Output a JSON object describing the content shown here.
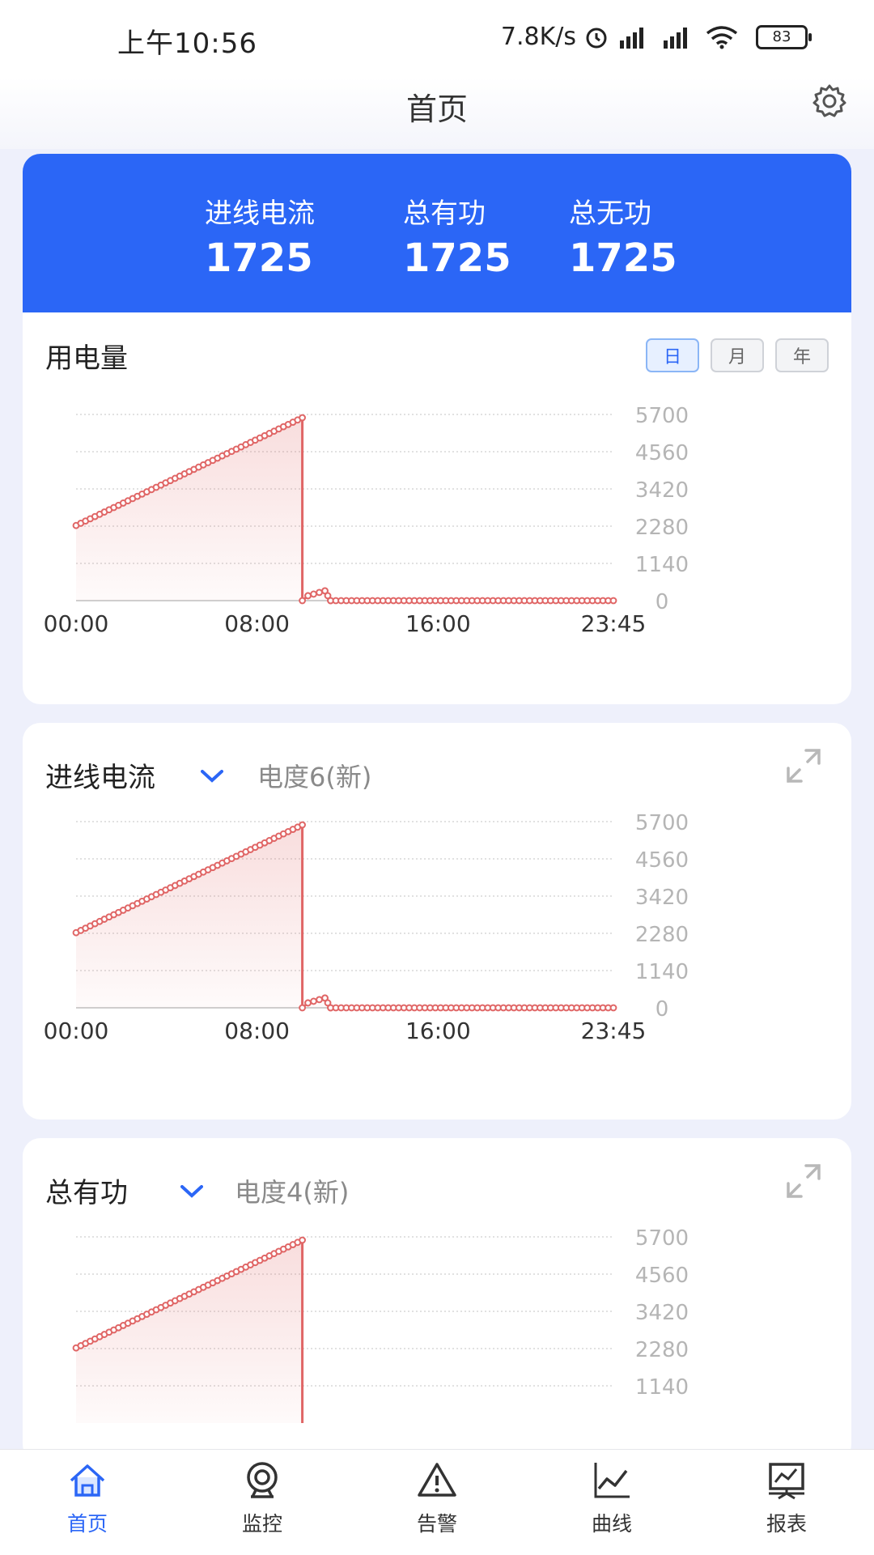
{
  "status": {
    "time": "上午10:56",
    "speed": "7.8K/s",
    "battery": "83"
  },
  "header": {
    "title": "首页",
    "settings_icon": "gear-icon"
  },
  "summary": {
    "metrics": [
      {
        "label": "进线电流",
        "value": "1725"
      },
      {
        "label": "总有功",
        "value": "1725"
      },
      {
        "label": "总无功",
        "value": "1725"
      }
    ]
  },
  "cards": [
    {
      "title": "用电量",
      "range_buttons": [
        "日",
        "月",
        "年"
      ],
      "selected_range": "日"
    },
    {
      "title": "进线电流",
      "dropdown_icon": "chevron-down-icon",
      "subtitle": "电度6(新)",
      "expand_icon": "expand-icon"
    },
    {
      "title": "总有功",
      "dropdown_icon": "chevron-down-icon",
      "subtitle": "电度4(新)",
      "expand_icon": "expand-icon"
    }
  ],
  "colors": {
    "accent": "#2b66f6",
    "series": "#e06666",
    "grid": "#cfcfcf"
  },
  "tabs": [
    {
      "label": "首页",
      "icon": "home-icon",
      "active": true
    },
    {
      "label": "监控",
      "icon": "camera-icon",
      "active": false
    },
    {
      "label": "告警",
      "icon": "warning-icon",
      "active": false
    },
    {
      "label": "曲线",
      "icon": "line-chart-icon",
      "active": false
    },
    {
      "label": "报表",
      "icon": "report-icon",
      "active": false
    }
  ],
  "chart_data": [
    {
      "type": "area",
      "x_ticks": [
        "00:00",
        "08:00",
        "16:00",
        "23:45"
      ],
      "y_ticks": [
        "0",
        "1140",
        "2280",
        "3420",
        "4560",
        "5700"
      ],
      "ylim": [
        0,
        5700
      ],
      "grid": true,
      "series": [
        {
          "x": [
            "00:00",
            "10:00",
            "10:00",
            "10:15",
            "11:00",
            "11:15",
            "23:45"
          ],
          "values": [
            2300,
            5600,
            0,
            150,
            300,
            0,
            0
          ]
        }
      ]
    },
    {
      "type": "area",
      "x_ticks": [
        "00:00",
        "08:00",
        "16:00",
        "23:45"
      ],
      "y_ticks": [
        "0",
        "1140",
        "2280",
        "3420",
        "4560",
        "5700"
      ],
      "ylim": [
        0,
        5700
      ],
      "grid": true,
      "series": [
        {
          "x": [
            "00:00",
            "10:00",
            "10:00",
            "10:15",
            "11:00",
            "11:15",
            "23:45"
          ],
          "values": [
            2300,
            5600,
            0,
            150,
            300,
            0,
            0
          ]
        }
      ]
    },
    {
      "type": "area",
      "x_ticks": [],
      "y_ticks": [
        "1140",
        "2280",
        "3420",
        "4560",
        "5700"
      ],
      "ylim": [
        0,
        5700
      ],
      "grid": true,
      "series": [
        {
          "x": [
            "00:00",
            "10:00",
            "10:00"
          ],
          "values": [
            2300,
            5600,
            0
          ]
        }
      ]
    }
  ]
}
